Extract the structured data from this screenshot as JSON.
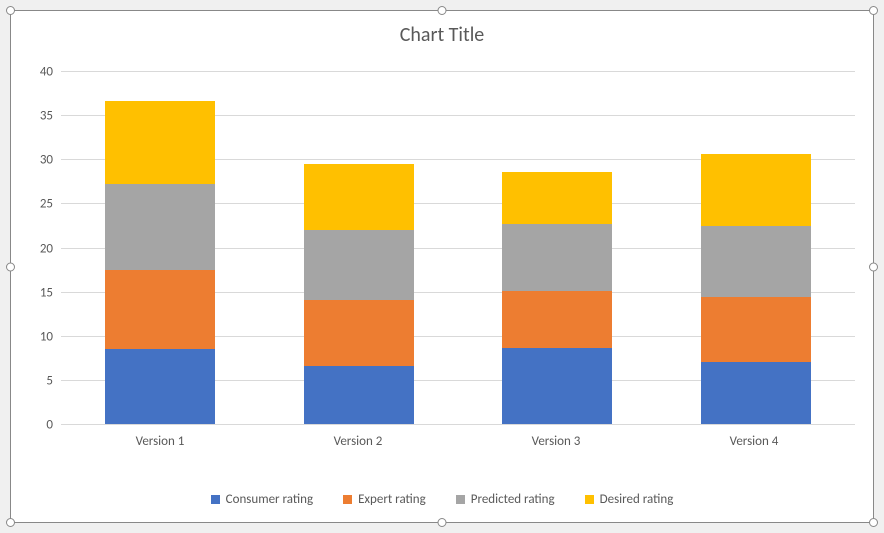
{
  "chart_data": {
    "type": "bar",
    "stacked": true,
    "title": "Chart Title",
    "xlabel": "",
    "ylabel": "",
    "ylim": [
      0,
      40
    ],
    "ytick_step": 5,
    "categories": [
      "Version 1",
      "Version 2",
      "Version 3",
      "Version 4"
    ],
    "series": [
      {
        "name": "Consumer rating",
        "color": "#4472C4",
        "values": [
          8.5,
          6.6,
          8.6,
          7.0
        ]
      },
      {
        "name": "Expert rating",
        "color": "#ED7D31",
        "values": [
          9.0,
          7.4,
          6.5,
          7.4
        ]
      },
      {
        "name": "Predicted rating",
        "color": "#A5A5A5",
        "values": [
          9.7,
          8.0,
          7.6,
          8.0
        ]
      },
      {
        "name": "Desired rating",
        "color": "#FFC000",
        "values": [
          9.4,
          7.5,
          5.9,
          8.2
        ]
      }
    ],
    "yticks": [
      0,
      5,
      10,
      15,
      20,
      25,
      30,
      35,
      40
    ]
  }
}
